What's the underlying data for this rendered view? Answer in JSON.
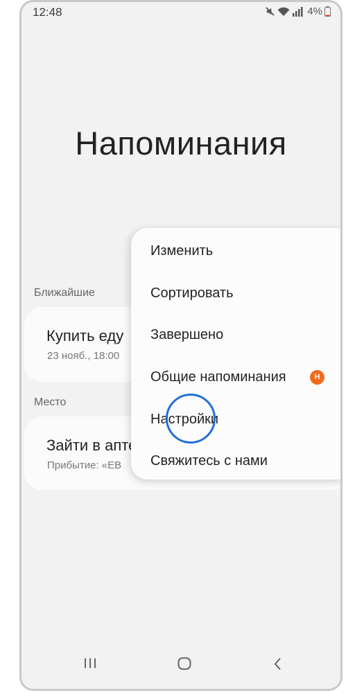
{
  "status_bar": {
    "time": "12:48",
    "battery": "4%"
  },
  "page": {
    "title": "Напоминания"
  },
  "sections": [
    {
      "label": "Ближайшие",
      "card": {
        "title": "Купить еду",
        "subtitle": "23 нояб., 18:00"
      }
    },
    {
      "label": "Место",
      "card": {
        "title": "Зайти в аптеку",
        "subtitle": "Прибытие: «ЕВ"
      }
    }
  ],
  "menu": {
    "items": [
      {
        "label": "Изменить"
      },
      {
        "label": "Сортировать"
      },
      {
        "label": "Завершено"
      },
      {
        "label": "Общие напоминания",
        "badge": "Н"
      },
      {
        "label": "Настройки"
      },
      {
        "label": "Свяжитесь с нами"
      }
    ]
  },
  "nav_icons": [
    "recents-icon",
    "home-icon",
    "back-icon"
  ],
  "colors": {
    "badge": "#ef6b1b",
    "highlight": "#1f6fd6",
    "background": "#f2f2f2"
  }
}
